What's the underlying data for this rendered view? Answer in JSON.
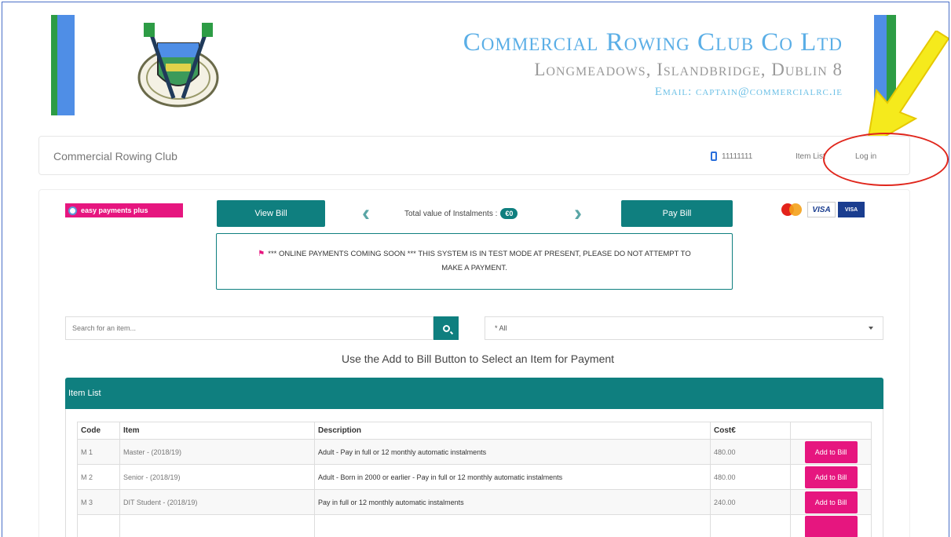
{
  "header": {
    "title": "Commercial Rowing Club Co Ltd",
    "address": "Longmeadows, Islandbridge, Dublin 8",
    "email": "Email: captain@commercialrc.ie",
    "accent_colors": {
      "green": "#2d9c45",
      "blue": "#4f8ee6"
    }
  },
  "navbar": {
    "brand": "Commercial Rowing Club",
    "phone": "11111111",
    "links": [
      "Item List",
      "Log in"
    ]
  },
  "toolbar": {
    "easy_payments_label": "easy payments plus",
    "view_bill_label": "View Bill",
    "total_label": "Total value of Instalments :",
    "total_value": "€0",
    "pay_bill_label": "Pay Bill",
    "card_logos": [
      "mastercard-icon",
      "visa-icon",
      "visa-electron-icon"
    ]
  },
  "notice": {
    "text": "*** ONLINE PAYMENTS COMING SOON *** THIS SYSTEM IS IN TEST MODE AT PRESENT, PLEASE DO NOT ATTEMPT TO MAKE A PAYMENT."
  },
  "search": {
    "placeholder": "Search for an item...",
    "category_selected": "* All"
  },
  "instruction": "Use the Add to Bill Button to Select an Item for Payment",
  "item_list": {
    "title": "Item List",
    "columns": [
      "Code",
      "Item",
      "Description",
      "Cost€",
      ""
    ],
    "rows": [
      {
        "code": "M 1",
        "item": "Master - (2018/19)",
        "description": "Adult - Pay in full or 12 monthly automatic instalments",
        "cost": "480.00",
        "action": "Add to Bill"
      },
      {
        "code": "M 2",
        "item": "Senior - (2018/19)",
        "description": "Adult - Born in 2000 or earlier - Pay in full or 12 monthly automatic instalments",
        "cost": "480.00",
        "action": "Add to Bill"
      },
      {
        "code": "M 3",
        "item": "DIT Student - (2018/19)",
        "description": "Pay in full or 12 monthly automatic instalments",
        "cost": "240.00",
        "action": "Add to Bill"
      }
    ]
  }
}
